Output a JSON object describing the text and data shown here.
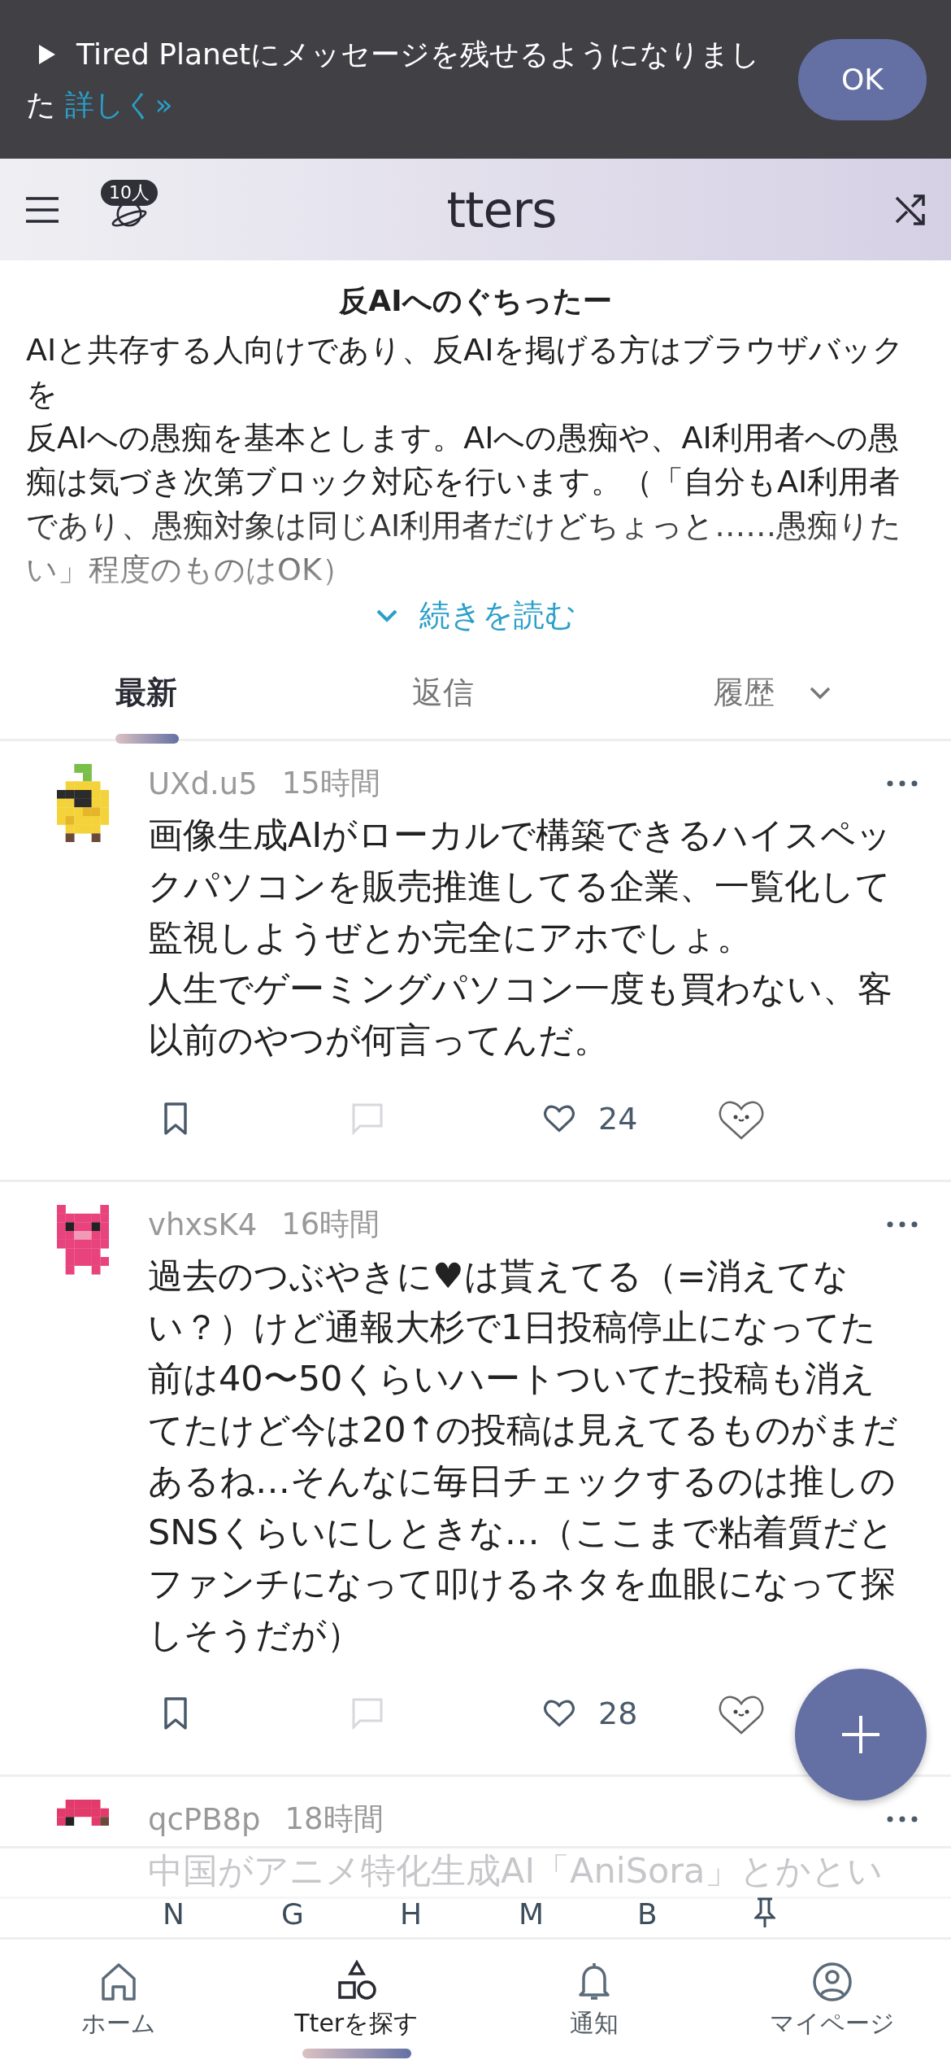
{
  "banner": {
    "message": "Tired Planetにメッセージを残せるようになりました",
    "link": "詳しく»",
    "button": "OK"
  },
  "header": {
    "member_badge": "10人",
    "logo": "tters"
  },
  "community": {
    "title": "反AIへのぐちったー",
    "description": [
      "AIと共存する人向けであり、反AIを掲げる方はブラウザバックを",
      "反AIへの愚痴を基本とします。AIへの愚痴や、AI利用者への愚痴は気づき次第ブロック対応を行います。（「自分もAI利用者であり、愚痴対象は同じAI利用者だけどちょっと……愚痴りたい」程度のものはOK）"
    ],
    "read_more": "続きを読む"
  },
  "tabs": [
    {
      "label": "最新",
      "selected": true,
      "kind": "tab"
    },
    {
      "label": "返信",
      "selected": false,
      "kind": "tab"
    },
    {
      "label": "履歴",
      "selected": false,
      "kind": "dropdown"
    }
  ],
  "posts": [
    {
      "user": "UXd.u5",
      "time": "15時間",
      "body": [
        "画像生成AIがローカルで構築できるハイスペックパソコンを販売推進してる企業、一覧化して監視しようぜとか完全にアホでしょ。",
        "人生でゲーミングパソコン一度も買わない、客以前のやつが何言ってんだ。"
      ],
      "likes": "24"
    },
    {
      "user": "vhxsK4",
      "time": "16時間",
      "body": [
        "過去のつぶやきに♥は貰えてる（=消えてない？）けど通報大杉で1日投稿停止になってた前は40〜50くらいハートついてた投稿も消えてたけど今は20↑の投稿は見えてるものがまだあるね…そんなに毎日チェックするのは推しのSNSくらいにしときな…（ここまで粘着質だとファンチになって叩けるネタを血眼になって探しそうだが）"
      ],
      "likes": "28"
    },
    {
      "user": "qcPB8p",
      "time": "18時間",
      "body": [
        "中国がアニメ特化生成AI「AniSora」とかとい"
      ]
    }
  ],
  "jump_bar": {
    "letters": [
      "N",
      "G",
      "H",
      "M",
      "B"
    ]
  },
  "nav": [
    {
      "label": "ホーム",
      "selected": false
    },
    {
      "label": "Tterを探す",
      "selected": true
    },
    {
      "label": "通知",
      "selected": false
    },
    {
      "label": "マイページ",
      "selected": false
    }
  ]
}
